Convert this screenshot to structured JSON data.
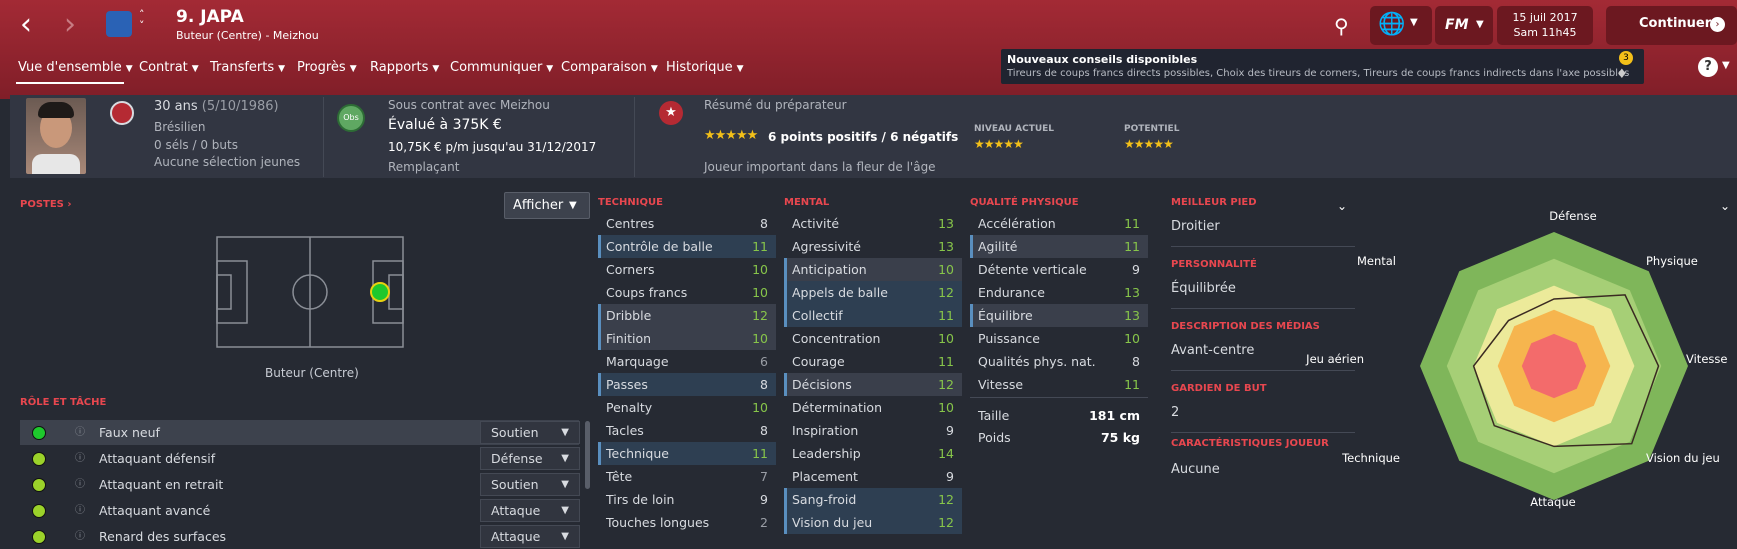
{
  "player": {
    "name": "9. JAPA",
    "subtitle": "Buteur (Centre) - Meizhou"
  },
  "topbar": {
    "date": "15 juil 2017",
    "time": "Sam 11h45",
    "continue_label": "Continuer",
    "fm_label": "FM"
  },
  "menu": [
    {
      "label": "Vue d'ensemble"
    },
    {
      "label": "Contrat"
    },
    {
      "label": "Transferts"
    },
    {
      "label": "Progrès"
    },
    {
      "label": "Rapports"
    },
    {
      "label": "Communiquer"
    },
    {
      "label": "Comparaison"
    },
    {
      "label": "Historique"
    }
  ],
  "notification": {
    "title": "Nouveaux conseils disponibles",
    "text": "Tireurs de coups francs directs possibles, Choix des tireurs de corners, Tireurs de coups francs indirects dans l'axe possibles",
    "count": "3"
  },
  "info": {
    "age": "30 ans",
    "dob": "(5/10/1986)",
    "nationality": "Brésilien",
    "caps": "0 séls / 0 buts",
    "youth": "Aucune sélection jeunes"
  },
  "contract": {
    "badge": "Obs",
    "status": "Sous contrat avec Meizhou",
    "value": "Évalué à 375K €",
    "wage": "10,75K € p/m jusqu'au 31/12/2017",
    "role": "Remplaçant"
  },
  "scout": {
    "title": "Résumé du préparateur",
    "stars_text": "★★★★★",
    "summary": "6 points positifs / 6 négatifs",
    "current_label": "NIVEAU ACTUEL",
    "potential_label": "POTENTIEL",
    "note": "Joueur important dans la fleur de l'âge",
    "current_stars": "★★★★★",
    "potential_stars": "★★★★★"
  },
  "positions": {
    "label": "POSTES",
    "dropdown": "Afficher",
    "position_name": "Buteur (Centre)"
  },
  "roles": {
    "label": "RÔLE ET TÂCHE",
    "items": [
      {
        "name": "Faux neuf",
        "duty": "Soutien",
        "color": "#1ec82d"
      },
      {
        "name": "Attaquant défensif",
        "duty": "Défense",
        "color": "#9bd22a"
      },
      {
        "name": "Attaquant en retrait",
        "duty": "Soutien",
        "color": "#9bd22a"
      },
      {
        "name": "Attaquant avancé",
        "duty": "Attaque",
        "color": "#9bd22a"
      },
      {
        "name": "Renard des surfaces",
        "duty": "Attaque",
        "color": "#9bd22a"
      }
    ]
  },
  "attributes": {
    "technique_label": "TECHNIQUE",
    "mental_label": "MENTAL",
    "physical_label": "QUALITÉ PHYSIQUE",
    "technique": [
      {
        "name": "Centres",
        "value": "8"
      },
      {
        "name": "Contrôle de balle",
        "value": "11"
      },
      {
        "name": "Corners",
        "value": "10"
      },
      {
        "name": "Coups francs",
        "value": "10"
      },
      {
        "name": "Dribble",
        "value": "12"
      },
      {
        "name": "Finition",
        "value": "10"
      },
      {
        "name": "Marquage",
        "value": "6"
      },
      {
        "name": "Passes",
        "value": "8"
      },
      {
        "name": "Penalty",
        "value": "10"
      },
      {
        "name": "Tacles",
        "value": "8"
      },
      {
        "name": "Technique",
        "value": "11"
      },
      {
        "name": "Tête",
        "value": "7"
      },
      {
        "name": "Tirs de loin",
        "value": "9"
      },
      {
        "name": "Touches longues",
        "value": "2"
      }
    ],
    "mental": [
      {
        "name": "Activité",
        "value": "13"
      },
      {
        "name": "Agressivité",
        "value": "13"
      },
      {
        "name": "Anticipation",
        "value": "10"
      },
      {
        "name": "Appels de balle",
        "value": "12"
      },
      {
        "name": "Collectif",
        "value": "11"
      },
      {
        "name": "Concentration",
        "value": "10"
      },
      {
        "name": "Courage",
        "value": "11"
      },
      {
        "name": "Décisions",
        "value": "12"
      },
      {
        "name": "Détermination",
        "value": "10"
      },
      {
        "name": "Inspiration",
        "value": "9"
      },
      {
        "name": "Leadership",
        "value": "14"
      },
      {
        "name": "Placement",
        "value": "9"
      },
      {
        "name": "Sang-froid",
        "value": "12"
      },
      {
        "name": "Vision du jeu",
        "value": "12"
      }
    ],
    "physical": [
      {
        "name": "Accélération",
        "value": "11"
      },
      {
        "name": "Agilité",
        "value": "11"
      },
      {
        "name": "Détente verticale",
        "value": "9"
      },
      {
        "name": "Endurance",
        "value": "13"
      },
      {
        "name": "Équilibre",
        "value": "13"
      },
      {
        "name": "Puissance",
        "value": "10"
      },
      {
        "name": "Qualités phys. nat.",
        "value": "8"
      },
      {
        "name": "Vitesse",
        "value": "11"
      }
    ],
    "height_label": "Taille",
    "height": "181 cm",
    "weight_label": "Poids",
    "weight": "75 kg"
  },
  "details": {
    "foot_label": "MEILLEUR PIED",
    "foot": "Droitier",
    "personality_label": "PERSONNALITÉ",
    "personality": "Équilibrée",
    "media_label": "DESCRIPTION DES MÉDIAS",
    "media": "Avant-centre",
    "gk_label": "GARDIEN DE BUT",
    "gk": "2",
    "traits_label": "CARACTÉRISTIQUES JOUEUR",
    "traits": "Aucune"
  },
  "spider": {
    "labels": [
      "Défense",
      "Physique",
      "Vitesse",
      "Vision du jeu",
      "Attaque",
      "Technique",
      "Jeu aérien",
      "Mental"
    ],
    "values": [
      0.5,
      0.75,
      0.78,
      0.82,
      0.6,
      0.63,
      0.6,
      0.48
    ]
  },
  "colors": {
    "accent": "#e8474f",
    "topbar": "#a32a35",
    "green": "#87c54a"
  }
}
